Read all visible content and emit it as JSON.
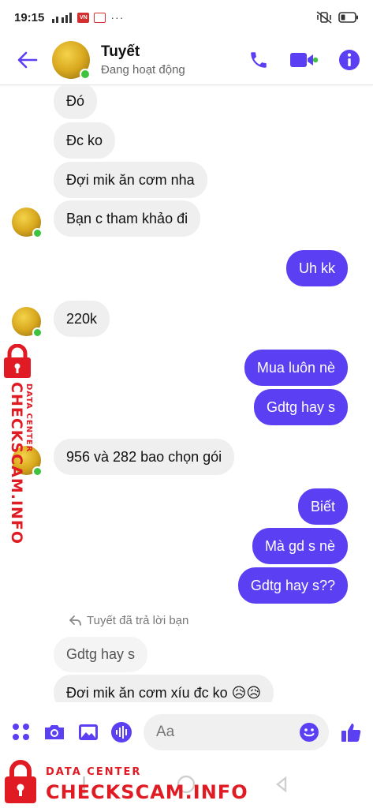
{
  "status_bar": {
    "time": "19:15",
    "badge": "VN",
    "more": "···"
  },
  "header": {
    "name": "Tuyết",
    "status": "Đang hoạt động"
  },
  "messages": [
    {
      "side": "in",
      "text": "Đó"
    },
    {
      "side": "in",
      "text": "Đc ko"
    },
    {
      "side": "in",
      "text": "Đợi mik ăn cơm nha"
    },
    {
      "side": "in",
      "text": "Bạn c tham khảo đi"
    },
    {
      "side": "out",
      "text": "Uh kk"
    },
    {
      "side": "in",
      "text": "220k"
    },
    {
      "side": "out",
      "text": "Mua luôn nè"
    },
    {
      "side": "out",
      "text": "Gdtg hay s"
    },
    {
      "side": "in",
      "text": "956 và 282 bao chọn gói"
    },
    {
      "side": "out",
      "text": "Biết"
    },
    {
      "side": "out",
      "text": "Mà gd s nè"
    },
    {
      "side": "out",
      "text": "Gdtg hay s??"
    },
    {
      "side": "in",
      "text": "Đơi mik ăn cơm xíu đc ko 😥😥"
    }
  ],
  "reply": {
    "note": "Tuyết đã trả lời bạn",
    "quoted": "Gdtg hay s"
  },
  "composer": {
    "placeholder": "Aa"
  },
  "watermark": {
    "line1": "DATA CENTER",
    "line2": "CHECKSCAM.INFO"
  },
  "colors": {
    "accent": "#5b3ff2",
    "online": "#3ec33e",
    "watermark": "#e01b24"
  }
}
